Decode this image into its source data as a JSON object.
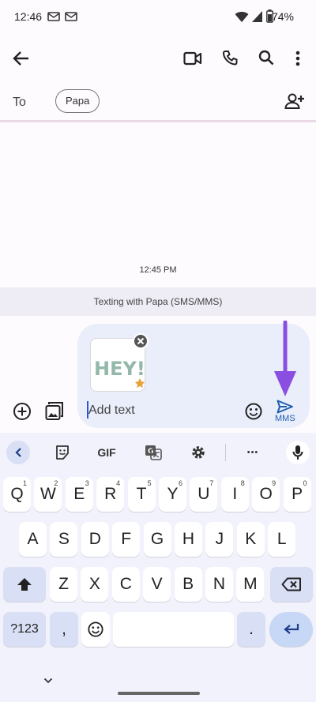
{
  "status": {
    "time": "12:46",
    "battery": "74%"
  },
  "header": {
    "to_label": "To",
    "recipient": "Papa"
  },
  "conversation": {
    "time": "12:45 PM",
    "banner": "Texting with Papa (SMS/MMS)"
  },
  "compose": {
    "sticker_text": "HEY!",
    "placeholder": "Add text",
    "send_label": "MMS"
  },
  "keyboard": {
    "toolbar": {
      "gif": "GIF",
      "more": "•••"
    },
    "row1": [
      {
        "k": "Q",
        "h": "1"
      },
      {
        "k": "W",
        "h": "2"
      },
      {
        "k": "E",
        "h": "3"
      },
      {
        "k": "R",
        "h": "4"
      },
      {
        "k": "T",
        "h": "5"
      },
      {
        "k": "Y",
        "h": "6"
      },
      {
        "k": "U",
        "h": "7"
      },
      {
        "k": "I",
        "h": "8"
      },
      {
        "k": "O",
        "h": "9"
      },
      {
        "k": "P",
        "h": "0"
      }
    ],
    "row2": [
      "A",
      "S",
      "D",
      "F",
      "G",
      "H",
      "J",
      "K",
      "L"
    ],
    "row3": [
      "Z",
      "X",
      "C",
      "V",
      "B",
      "N",
      "M"
    ],
    "symbols": "?123",
    "comma": ",",
    "period": "."
  },
  "colors": {
    "accent": "#8a4fe0",
    "send": "#1f5fb0",
    "keyboard_bg": "#f1f2fb"
  }
}
